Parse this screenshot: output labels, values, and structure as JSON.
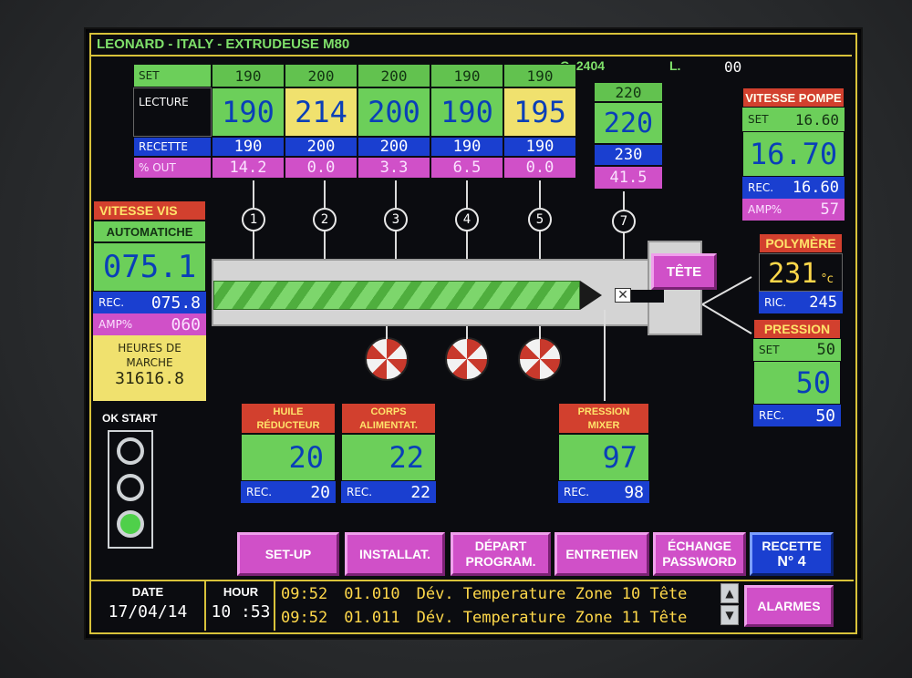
{
  "header": {
    "title": "LEONARD - ITALY - EXTRUDEUSE M80",
    "counter": "C. 2404",
    "l_label": "L.",
    "l_value": "00"
  },
  "zones": {
    "row_labels": {
      "set": "SET",
      "lecture": "LECTURE",
      "recette": "RECETTE",
      "out": "% OUT"
    },
    "cols": [
      {
        "set": "190",
        "lecture": "190",
        "recette": "190",
        "out": "14.2",
        "num": "1"
      },
      {
        "set": "200",
        "lecture": "214",
        "recette": "200",
        "out": "0.0",
        "num": "2"
      },
      {
        "set": "200",
        "lecture": "200",
        "recette": "200",
        "out": "3.3",
        "num": "3"
      },
      {
        "set": "190",
        "lecture": "190",
        "recette": "190",
        "out": "6.5",
        "num": "4"
      },
      {
        "set": "190",
        "lecture": "195",
        "recette": "190",
        "out": "0.0",
        "num": "5"
      }
    ],
    "zone7": {
      "set": "220",
      "lecture": "220",
      "recette": "230",
      "out": "41.5",
      "num": "7"
    }
  },
  "vitesse_pompe": {
    "title": "VITESSE POMPE",
    "set_label": "SET",
    "set": "16.60",
    "value": "16.70",
    "rec_label": "REC.",
    "rec": "16.60",
    "amp_label": "AMP%",
    "amp": "57"
  },
  "vitesse_vis": {
    "title": "VITESSE VIS",
    "mode": "AUTOMATICHE",
    "value": "075.1",
    "rec_label": "REC.",
    "rec": "075.8",
    "amp_label": "AMP%",
    "amp": "060",
    "heures_label1": "HEURES DE",
    "heures_label2": "MARCHE",
    "heures": "31616.8"
  },
  "tete_label": "TÊTE",
  "polymere": {
    "title": "POLYMÈRE",
    "value": "231",
    "unit": "°c",
    "ric_label": "RIC.",
    "ric": "245"
  },
  "pression": {
    "title": "PRESSION",
    "set_label": "SET",
    "set": "50",
    "value": "50",
    "rec_label": "REC.",
    "rec": "50"
  },
  "huile": {
    "title1": "HUILE",
    "title2": "RÉDUCTEUR",
    "value": "20",
    "rec_label": "REC.",
    "rec": "20"
  },
  "corps": {
    "title1": "CORPS",
    "title2": "ALIMENTAT.",
    "value": "22",
    "rec_label": "REC.",
    "rec": "22"
  },
  "mixer": {
    "title1": "PRESSION",
    "title2": "MIXER",
    "value": "97",
    "rec_label": "REC.",
    "rec": "98"
  },
  "ok_start": "OK START",
  "buttons": {
    "setup": "SET-UP",
    "install": "INSTALLAT.",
    "depart1": "DÉPART",
    "depart2": "PROGRAM.",
    "entretien": "ENTRETIEN",
    "echange1": "ÉCHANGE",
    "echange2": "PASSWORD",
    "recette1": "RECETTE",
    "recette2": "N°  4",
    "alarmes": "ALARMES"
  },
  "footer": {
    "date_label": "DATE",
    "date": "17/04/14",
    "hour_label": "HOUR",
    "hour": "10 :53",
    "alarms": [
      {
        "time": "09:52",
        "code": "01.010",
        "text": "Dév. Temperature Zone 10 Tête"
      },
      {
        "time": "09:52",
        "code": "01.011",
        "text": "Dév. Temperature Zone 11 Tête"
      }
    ]
  },
  "colors": {
    "green": "#6ccf5a",
    "yellow": "#f0e16e",
    "blue": "#1a3fd0",
    "magenta": "#d050c8",
    "red": "#d2402e",
    "frame": "#d8c23a"
  },
  "icons": [
    "scroll-up-icon",
    "scroll-down-icon",
    "fan-icon",
    "status-lamp-icon"
  ]
}
